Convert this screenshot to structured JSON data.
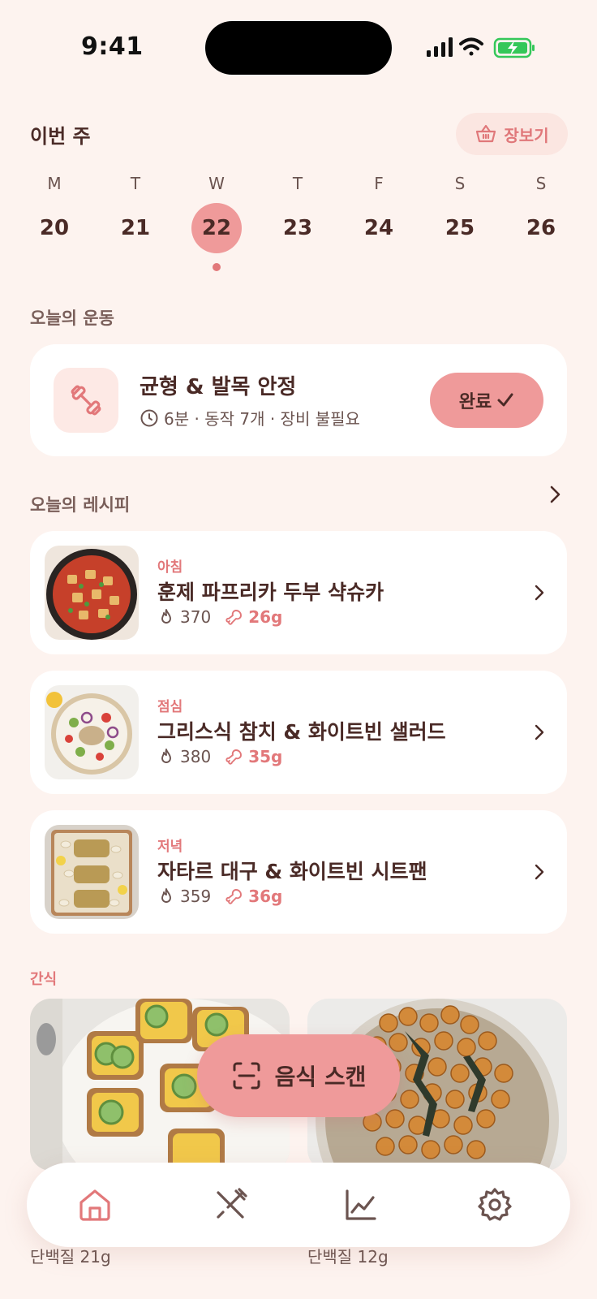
{
  "status": {
    "time": "9:41"
  },
  "header": {
    "title": "이번 주",
    "shop_label": "장보기"
  },
  "calendar": {
    "days": [
      {
        "letter": "M",
        "num": "20"
      },
      {
        "letter": "T",
        "num": "21"
      },
      {
        "letter": "W",
        "num": "22",
        "selected": true
      },
      {
        "letter": "T",
        "num": "23"
      },
      {
        "letter": "F",
        "num": "24"
      },
      {
        "letter": "S",
        "num": "25"
      },
      {
        "letter": "S",
        "num": "26"
      }
    ]
  },
  "workout": {
    "section_label": "오늘의 운동",
    "title": "균형 & 발목 안정",
    "meta": "6분 · 동작 7개 · 장비 불필요",
    "done_label": "완료"
  },
  "recipes": {
    "section_label": "오늘의 레시피",
    "items": [
      {
        "meal": "아침",
        "name": "훈제 파프리카 두부 샥슈카",
        "kcal": "370",
        "protein": "26g"
      },
      {
        "meal": "점심",
        "name": "그리스식 참치 & 화이트빈 샐러드",
        "kcal": "380",
        "protein": "35g"
      },
      {
        "meal": "저녁",
        "name": "자타르 대구 & 화이트빈 시트팬",
        "kcal": "359",
        "protein": "36g"
      }
    ]
  },
  "snacks": {
    "section_label": "간식",
    "items": [
      {
        "protein": "단백질 21g"
      },
      {
        "protein": "단백질 12g"
      }
    ]
  },
  "scan": {
    "label": "음식 스캔"
  },
  "tabs": [
    "home-icon",
    "utensils-icon",
    "chart-icon",
    "settings-icon"
  ],
  "colors": {
    "accent": "#ef9a9a",
    "accent_text": "#e2787a",
    "background": "#fdf3ef",
    "text": "#4a2a26"
  }
}
